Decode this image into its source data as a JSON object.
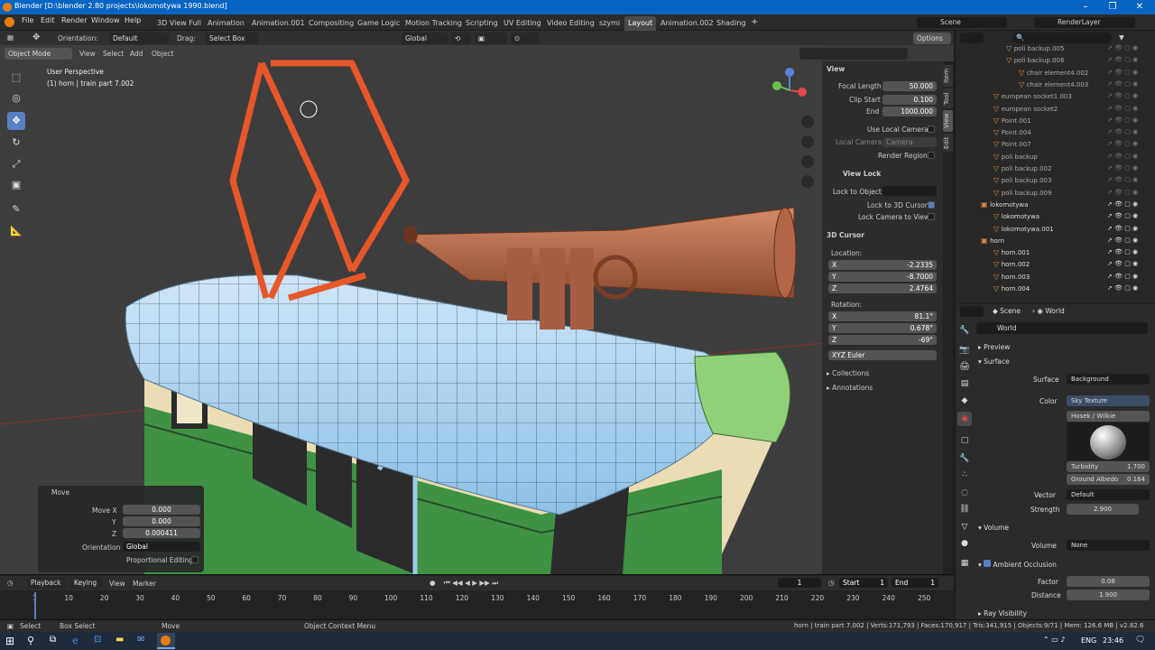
{
  "window": {
    "title": "Blender [D:\\blender 2.80 projects\\lokomotywa 1990.blend]",
    "min": "–",
    "max": "❐",
    "close": "✕"
  },
  "menus": [
    "File",
    "Edit",
    "Render",
    "Window",
    "Help"
  ],
  "workspaces": [
    "3D View Full",
    "Animation",
    "Animation.001",
    "Compositing",
    "Game Logic",
    "Motion Tracking",
    "Scripting",
    "UV Editing",
    "Video Editing",
    "szymi",
    "Layout",
    "Animation.002",
    "Shading"
  ],
  "active_workspace": "Layout",
  "scene": {
    "label": "Scene",
    "render_layer": "RenderLayer"
  },
  "viewport_header": {
    "orientation_label": "Orientation:",
    "orientation": "Default",
    "drag_label": "Drag:",
    "drag": "Select Box",
    "transform": "Global",
    "options": "Options",
    "mode": "Object Mode",
    "menus": [
      "View",
      "Select",
      "Add",
      "Object"
    ]
  },
  "viewport": {
    "perspective": "User Perspective",
    "object": "(1) horn | train part 7.002"
  },
  "npanel": {
    "view_section": "View",
    "focal_length_label": "Focal Length",
    "focal_length": "50.000",
    "clip_start_label": "Clip Start",
    "clip_start": "0.100",
    "end_label": "End",
    "end": "1000.000",
    "use_local_camera": "Use Local Camera",
    "local_camera_label": "Local Camera",
    "local_camera": "Camera",
    "render_region": "Render Region",
    "view_lock_section": "View Lock",
    "lock_to_object_label": "Lock to Object",
    "lock_to_3d_cursor": "Lock to 3D Cursor",
    "lock_camera_to_view": "Lock Camera to View",
    "cursor_section": "3D Cursor",
    "location_label": "Location:",
    "loc": [
      {
        "axis": "X",
        "value": "-2.2335"
      },
      {
        "axis": "Y",
        "value": "-8.7000"
      },
      {
        "axis": "Z",
        "value": "2.4764"
      }
    ],
    "rotation_label": "Rotation:",
    "rot": [
      {
        "axis": "X",
        "value": "81.1°"
      },
      {
        "axis": "Y",
        "value": "0.678°"
      },
      {
        "axis": "Z",
        "value": "-69°"
      }
    ],
    "rotation_mode": "XYZ Euler",
    "collections": "Collections",
    "annotations": "Annotations",
    "tabs": [
      "Item",
      "Tool",
      "View",
      "Edit"
    ]
  },
  "move_panel": {
    "title": "Move",
    "rows": [
      {
        "label": "Move X",
        "value": "0.000"
      },
      {
        "label": "Y",
        "value": "0.000"
      },
      {
        "label": "Z",
        "value": "0.000411"
      }
    ],
    "orientation_label": "Orientation",
    "orientation": "Global",
    "proportional": "Proportional Editing"
  },
  "outliner": {
    "rows": [
      {
        "name": "poli backup.005",
        "indent": 3,
        "vis": false
      },
      {
        "name": "poli backup.006",
        "indent": 3,
        "vis": false
      },
      {
        "name": "chair element4.002",
        "indent": 4,
        "vis": false
      },
      {
        "name": "chair element4.003",
        "indent": 4,
        "vis": false
      },
      {
        "name": "european socket1.003",
        "indent": 2,
        "vis": false
      },
      {
        "name": "european socket2",
        "indent": 2,
        "vis": false
      },
      {
        "name": "Point.001",
        "indent": 2,
        "vis": false
      },
      {
        "name": "Point.004",
        "indent": 2,
        "vis": false
      },
      {
        "name": "Point.007",
        "indent": 2,
        "vis": false
      },
      {
        "name": "poli backup",
        "indent": 2,
        "vis": false
      },
      {
        "name": "poli backup.002",
        "indent": 2,
        "vis": false
      },
      {
        "name": "poli backup.003",
        "indent": 2,
        "vis": false
      },
      {
        "name": "poli backup.009",
        "indent": 2,
        "vis": false
      },
      {
        "name": "lokomotywa",
        "indent": 1,
        "vis": true
      },
      {
        "name": "lokomotywa",
        "indent": 2,
        "vis": true
      },
      {
        "name": "lokomotywa.001",
        "indent": 2,
        "vis": true
      },
      {
        "name": "horn",
        "indent": 1,
        "vis": true
      },
      {
        "name": "horn.001",
        "indent": 2,
        "vis": true
      },
      {
        "name": "horn.002",
        "indent": 2,
        "vis": true
      },
      {
        "name": "horn.003",
        "indent": 2,
        "vis": true
      },
      {
        "name": "horn.004",
        "indent": 2,
        "vis": true
      }
    ]
  },
  "properties": {
    "scene": "Scene",
    "world_tab": "World",
    "world_name": "World",
    "preview": "Preview",
    "surface": "Surface",
    "surface_label": "Surface",
    "surface_val": "Background",
    "color_label": "Color",
    "color_val": "Sky Texture",
    "sky_model": "Hosek / Wilkie",
    "turbidity_label": "Turbidity",
    "turbidity": "1.700",
    "ground_albedo_label": "Ground Albedo",
    "ground_albedo": "0.164",
    "vector_label": "Vector",
    "vector_val": "Default",
    "strength_label": "Strength",
    "strength": "2.900",
    "volume": "Volume",
    "volume_label": "Volume",
    "volume_val": "None",
    "ao": "Ambient Occlusion",
    "factor_label": "Factor",
    "factor": "0.08",
    "distance_label": "Distance",
    "distance": "1.900",
    "ray_visibility": "Ray Visibility"
  },
  "timeline": {
    "menus": [
      "Playback",
      "Keying",
      "View",
      "Marker"
    ],
    "current": "1",
    "start_label": "Start",
    "start": "1",
    "end_label": "End",
    "end": "1",
    "ticks": [
      "1",
      "10",
      "20",
      "30",
      "40",
      "50",
      "60",
      "70",
      "80",
      "90",
      "100",
      "110",
      "120",
      "130",
      "140",
      "150",
      "160",
      "170",
      "180",
      "190",
      "200",
      "210",
      "220",
      "230",
      "240",
      "250"
    ]
  },
  "status": {
    "select": "Select",
    "box_select": "Box Select",
    "move": "Move",
    "context": "Object Context Menu",
    "stats": "horn | train part 7.002 | Verts:171,793 | Faces:170,917 | Tris:341,915 | Objects:9/71 | Mem: 126.6 MB | v2.82.6"
  },
  "taskbar": {
    "lang": "ENG",
    "time": "23:46"
  }
}
